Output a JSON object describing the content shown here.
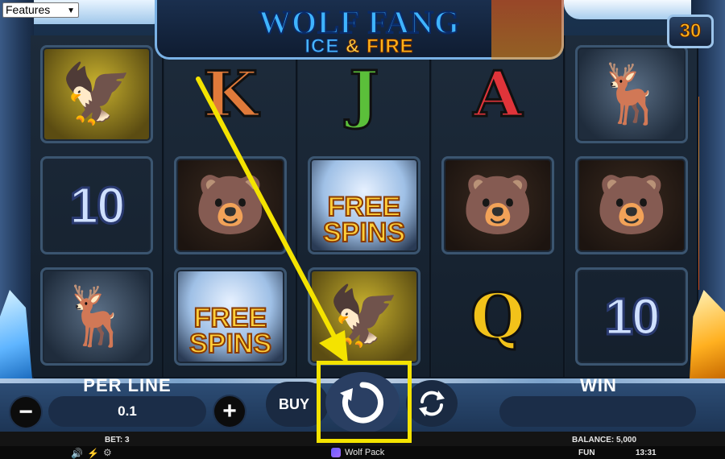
{
  "features_select": {
    "value": "Features",
    "options": [
      "Features"
    ]
  },
  "title": {
    "main": "WOLF FANG",
    "sub_ice": "ICE",
    "sub_amp": "&",
    "sub_fire": "FIRE"
  },
  "lines_badge": "30",
  "reels": [
    [
      {
        "symbol": "hawk",
        "kind": "animal",
        "glyph": "🦅"
      },
      {
        "symbol": "ten",
        "kind": "ten",
        "glyph": "10"
      },
      {
        "symbol": "deer",
        "kind": "animal",
        "glyph": "🦌"
      }
    ],
    [
      {
        "symbol": "king",
        "kind": "letter",
        "glyph": "K",
        "color": "#e07a3a"
      },
      {
        "symbol": "bear",
        "kind": "animal",
        "glyph": "🐻"
      },
      {
        "symbol": "free-spins",
        "kind": "scatter",
        "glyph": "FREE SPINS"
      }
    ],
    [
      {
        "symbol": "jack",
        "kind": "letter",
        "glyph": "J",
        "color": "#5bbf3a"
      },
      {
        "symbol": "free-spins",
        "kind": "scatter",
        "glyph": "FREE SPINS"
      },
      {
        "symbol": "hawk",
        "kind": "animal",
        "glyph": "🦅"
      }
    ],
    [
      {
        "symbol": "ace",
        "kind": "letter",
        "glyph": "A",
        "color": "#e0343a"
      },
      {
        "symbol": "bear",
        "kind": "animal",
        "glyph": "🐻"
      },
      {
        "symbol": "queen",
        "kind": "letter",
        "glyph": "Q",
        "color": "#f2c21a"
      }
    ],
    [
      {
        "symbol": "deer",
        "kind": "animal",
        "glyph": "🦌"
      },
      {
        "symbol": "bear",
        "kind": "animal",
        "glyph": "🐻"
      },
      {
        "symbol": "ten",
        "kind": "ten",
        "glyph": "10"
      }
    ]
  ],
  "controls": {
    "per_line_label": "PER LINE",
    "per_line_value": "0.1",
    "minus": "−",
    "plus": "+",
    "buy": "BUY",
    "win_label": "WIN",
    "win_value": ""
  },
  "status": {
    "bet": "BET: 3",
    "balance": "BALANCE: 5,000",
    "brand": "Wolf Pack",
    "mode": "FUN",
    "clock": "13:31"
  },
  "colors": {
    "highlight": "#f4e300",
    "scatter_text": "#ffcf3a",
    "title_blue": "#3fb4ff",
    "fire_orange": "#ffb21a"
  },
  "icons": [
    "spin-icon",
    "autospin-icon",
    "sound-icon",
    "turbo-icon",
    "brand-logo-icon"
  ]
}
